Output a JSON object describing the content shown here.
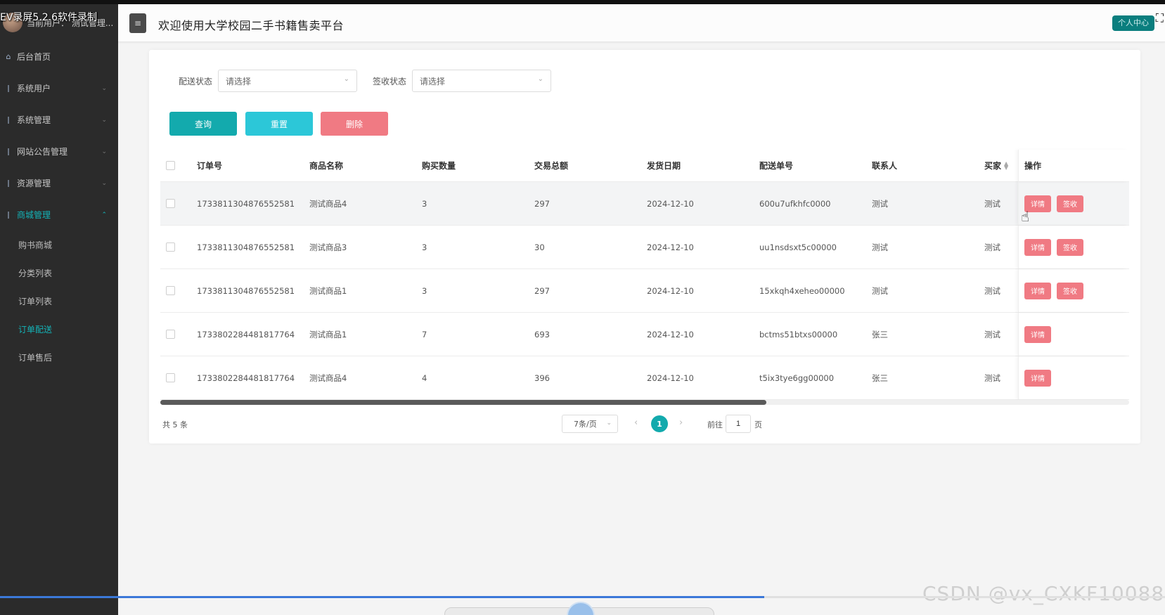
{
  "recorder": {
    "title": "EV录屏5.2.6软件录制"
  },
  "sidebar": {
    "user_text": "当前用户：  测试管理...",
    "items": [
      {
        "label": "后台首页",
        "icon": "home-icon"
      },
      {
        "label": "系统用户"
      },
      {
        "label": "系统管理"
      },
      {
        "label": "网站公告管理"
      },
      {
        "label": "资源管理"
      },
      {
        "label": "商城管理"
      }
    ],
    "sub_items": [
      {
        "label": "购书商城"
      },
      {
        "label": "分类列表"
      },
      {
        "label": "订单列表"
      },
      {
        "label": "订单配送"
      },
      {
        "label": "订单售后"
      }
    ]
  },
  "header": {
    "title": "欢迎使用大学校园二手书籍售卖平台",
    "personal_center": "个人中心"
  },
  "filters": {
    "delivery_status_label": "配送状态",
    "delivery_status_value": "请选择",
    "receipt_status_label": "签收状态",
    "receipt_status_value": "请选择"
  },
  "actions": {
    "query": "查询",
    "reset": "重置",
    "delete": "删除"
  },
  "table": {
    "headers": {
      "order_no": "订单号",
      "product_name": "商品名称",
      "quantity": "购买数量",
      "total": "交易总额",
      "ship_date": "发货日期",
      "delivery_no": "配送单号",
      "contact": "联系人",
      "buyer": "买家",
      "ops": "操作"
    },
    "rows": [
      {
        "order_no": "1733811304876552581",
        "product_name": "测试商品4",
        "quantity": "3",
        "total": "297",
        "ship_date": "2024-12-10",
        "delivery_no": "600u7ufkhfc0000",
        "contact": "测试",
        "buyer": "测试"
      },
      {
        "order_no": "1733811304876552581",
        "product_name": "测试商品3",
        "quantity": "3",
        "total": "30",
        "ship_date": "2024-12-10",
        "delivery_no": "uu1nsdsxt5c00000",
        "contact": "测试",
        "buyer": "测试"
      },
      {
        "order_no": "1733811304876552581",
        "product_name": "测试商品1",
        "quantity": "3",
        "total": "297",
        "ship_date": "2024-12-10",
        "delivery_no": "15xkqh4xeheo00000",
        "contact": "测试",
        "buyer": "测试"
      },
      {
        "order_no": "1733802284481817764",
        "product_name": "测试商品1",
        "quantity": "7",
        "total": "693",
        "ship_date": "2024-12-10",
        "delivery_no": "bctms51btxs00000",
        "contact": "张三",
        "buyer": "测试"
      },
      {
        "order_no": "1733802284481817764",
        "product_name": "测试商品4",
        "quantity": "4",
        "total": "396",
        "ship_date": "2024-12-10",
        "delivery_no": "t5ix3tye6gg00000",
        "contact": "张三",
        "buyer": "测试"
      }
    ],
    "detail_label": "详情",
    "sign_label": "签收"
  },
  "pagination": {
    "total_text": "共 5 条",
    "page_size": "7条/页",
    "current_page": "1",
    "goto_label": "前往",
    "goto_value": "1",
    "goto_unit": "页"
  },
  "watermark": "CSDN @vx_CXKF10088",
  "colors": {
    "accent": "#13aaad",
    "reset": "#2cc7d8",
    "danger": "#f07a83",
    "sidebar_bg": "#2b2b2b"
  }
}
